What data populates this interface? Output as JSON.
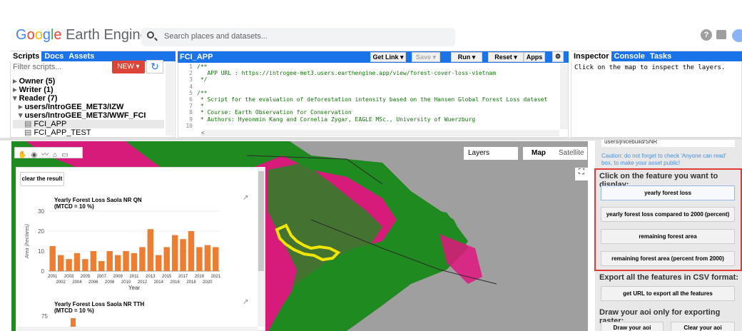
{
  "header": {
    "logo_google": [
      "G",
      "o",
      "o",
      "g",
      "l",
      "e"
    ],
    "logo_rest": "Earth Engine",
    "search_placeholder": "Search places and datasets..."
  },
  "left_panel": {
    "tabs": [
      "Scripts",
      "Docs",
      "Assets"
    ],
    "filter_placeholder": "Filter scripts...",
    "new_label": "NEW",
    "tree": [
      {
        "label": "Owner (5)",
        "indent": 0,
        "arrow": "▸"
      },
      {
        "label": "Writer (1)",
        "indent": 0,
        "arrow": "▸"
      },
      {
        "label": "Reader (7)",
        "indent": 0,
        "arrow": "▾"
      },
      {
        "label": "users/IntroGEE_MET3/IZW",
        "indent": 1,
        "arrow": "▸"
      },
      {
        "label": "users/IntroGEE_MET3/WWF_FCI",
        "indent": 1,
        "arrow": "▾"
      },
      {
        "label": "FCI_APP",
        "indent": 2,
        "arrow": ""
      },
      {
        "label": "FCI_APP_TEST",
        "indent": 2,
        "arrow": ""
      }
    ]
  },
  "editor": {
    "title": "FCI_APP",
    "buttons": {
      "get_link": "Get Link",
      "save": "Save",
      "run": "Run",
      "reset": "Reset",
      "apps": "Apps"
    },
    "lines": [
      {
        "n": "1",
        "text": "/**"
      },
      {
        "n": "2",
        "text": "   APP URL : https://introgee-met3.users.earthengine.app/view/forest-cover-loss-vietnam"
      },
      {
        "n": "3",
        "text": " */"
      },
      {
        "n": "4",
        "text": ""
      },
      {
        "n": "5",
        "text": "/**"
      },
      {
        "n": "6",
        "text": " * Script for the evaluation of deforestation intensity based on the Hansen Global Forest Loss dataset"
      },
      {
        "n": "7",
        "text": " *"
      },
      {
        "n": "8",
        "text": " * Course: Earth Observation for Conservation"
      },
      {
        "n": "9",
        "text": " * Authors: Hyeonmin Kang and Cornelia Zygar, EAGLE MSc., University of Wuerzburg"
      },
      {
        "n": "10",
        "text": ""
      }
    ]
  },
  "right_panel": {
    "tabs": [
      "Inspector",
      "Console",
      "Tasks"
    ],
    "message": "Click on the map to inspect the layers."
  },
  "map": {
    "layers_label": "Layers",
    "map_label": "Map",
    "satellite_label": "Satellite",
    "colors": {
      "forest": "#1f8a1f",
      "loss": "#e0157f",
      "bg": "#9f9f9f",
      "aoi": "#f2e500"
    }
  },
  "chart_panel": {
    "clear_label": "clear the result",
    "chart1_title": [
      "Yearly Forest Loss Saola NR QN",
      "(MTCD = 10 %)"
    ],
    "chart2_title": [
      "Yearly Forest Loss Saola NR TTH",
      "(MTCD = 10 %)"
    ],
    "chart2_ytick": "75"
  },
  "chart_data": {
    "type": "bar",
    "title": "Yearly Forest Loss Saola NR QN (MTCD = 10 %)",
    "xlabel": "Year",
    "ylabel": "Area (hectares)",
    "ylim": [
      0,
      30
    ],
    "yticks": [
      "0",
      "10",
      "20",
      "30"
    ],
    "categories": [
      "2001",
      "2002",
      "2003",
      "2004",
      "2005",
      "2006",
      "2007",
      "2008",
      "2009",
      "2010",
      "2011",
      "2012",
      "2013",
      "2014",
      "2015",
      "2016",
      "2017",
      "2018",
      "2019",
      "2020",
      "2021"
    ],
    "values": [
      12.5,
      8,
      6,
      9,
      6,
      10,
      5,
      10,
      8,
      10,
      9,
      12,
      21,
      8,
      12,
      18,
      16,
      20,
      12,
      13,
      12
    ],
    "color": "#ed7d31"
  },
  "side_panel": {
    "asset_text": "users/jnicebuild/SNR",
    "caution": "Caution: do not forget to check 'Anyone can read' box, to make your asset public!",
    "feature_title": "Click on the feature you want to display:",
    "feature_buttons": [
      "yearly forest loss",
      "yearly forest loss compared to 2000 (percent)",
      "remaining forest area",
      "remaining forest area (percent from 2000)"
    ],
    "export_title": "Export all the features in CSV format:",
    "export_button": "get URL to export all the features",
    "draw_title": "Draw your aoi only for exporting raster:",
    "draw_button": "Draw your aoi",
    "clear_button": "Clear your aoi",
    "highlight_color": "#e53935"
  }
}
